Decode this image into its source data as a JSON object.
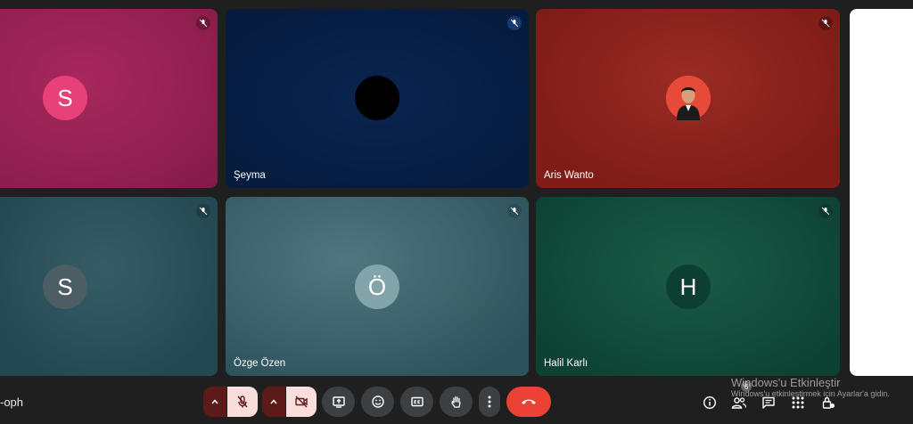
{
  "participants": [
    {
      "initial": "S",
      "name": "",
      "avatar_color": "#e8417a",
      "muted": true
    },
    {
      "initial": "",
      "name": "Şeyma",
      "avatar_color": "#000000",
      "muted": true
    },
    {
      "initial": "",
      "name": "Aris Wanto",
      "avatar_color": "#e84a3a",
      "muted": true
    },
    {
      "initial": "S",
      "name": "",
      "avatar_color": "#4c5e63",
      "muted": true
    },
    {
      "initial": "Ö",
      "name": "Özge Özen",
      "avatar_color": "#84a4ab",
      "muted": true
    },
    {
      "initial": "H",
      "name": "Halil Karlı",
      "avatar_color": "#0c3f31",
      "muted": true
    }
  ],
  "meeting": {
    "code": "-oph"
  },
  "controls": {
    "people_count": "6",
    "end_call_color": "#ea4335"
  },
  "watermark": {
    "title": "Windows'u Etkinleştir",
    "subtitle": "Windows'u etkinleştirmek için Ayarlar'a gidin."
  }
}
